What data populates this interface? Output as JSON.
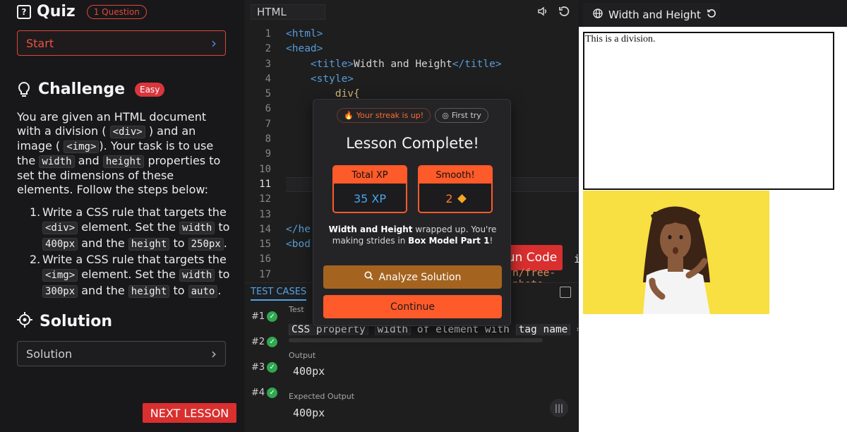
{
  "quiz": {
    "title": "Quiz",
    "count_badge": "1 Question",
    "start_label": "Start"
  },
  "challenge": {
    "title": "Challenge",
    "difficulty": "Easy",
    "desc": {
      "p1": "You are given an HTML document with a division (",
      "c1": "<div>",
      "p2": ") and an image (",
      "c2": "<img>",
      "p3": "). Your task is to use the",
      "c3": "width",
      "p4": "and",
      "c4": "height",
      "p5": "properties to set the dimensions of these elements. Follow the steps below:"
    },
    "steps": [
      {
        "num": "1.",
        "a": "Write a CSS rule that targets the",
        "c1": "<div>",
        "b": "element. Set the",
        "c2": "width",
        "c": "to",
        "c3": "400px",
        "d": "and the",
        "c4": "height",
        "e": "to",
        "c5": "250px",
        "f": "."
      },
      {
        "num": "2.",
        "a": "Write a CSS rule that targets the",
        "c1": "<img>",
        "b": "element. Set the",
        "c2": "width",
        "c": "to",
        "c3": "300px",
        "d": "and the",
        "c4": "height",
        "e": "to",
        "c5": "auto",
        "f": "."
      }
    ]
  },
  "solution": {
    "title": "Solution",
    "button_label": "Solution"
  },
  "next_lesson_label": "NEXT LESSON",
  "editor": {
    "tab_label": "HTML",
    "line_numbers": [
      "1",
      "2",
      "3",
      "4",
      "5",
      "6",
      "7",
      "8",
      "9",
      "10",
      "11",
      "12",
      "13",
      "14",
      "15",
      "16",
      "17"
    ],
    "lines": {
      "l1": "<html>",
      "l2": "<head>",
      "l3_open": "<title>",
      "l3_text": "Width and Height",
      "l3_close": "</title>",
      "l4": "<style>",
      "l5": "div{",
      "l14": "</he",
      "l15": "<bod"
    },
    "run_code_label": "un Code",
    "code_tail": "is",
    "url_tail": "n/free-photo"
  },
  "test_cases": {
    "label": "TEST CASES",
    "items": [
      "#1",
      "#2",
      "#3",
      "#4"
    ],
    "test_label": "Test",
    "test_text_1": "CSS property",
    "test_code_1": "width",
    "test_text_2": "of element with",
    "test_code_2": "tag name",
    "test_text_3": "=",
    "output_label": "Output",
    "output_value": "400px",
    "expected_label": "Expected Output",
    "expected_value": "400px"
  },
  "modal": {
    "streak_badge": "Your streak is up!",
    "first_try_badge": "First try",
    "title": "Lesson Complete!",
    "xp_label": "Total XP",
    "xp_value": "35 XP",
    "smooth_label": "Smooth!",
    "smooth_value": "2",
    "msg_bold_1": "Width and Height",
    "msg_1": "wrapped up. You're making strides in",
    "msg_bold_2": "Box Model Part 1",
    "msg_2": "!",
    "analyze_label": "Analyze Solution",
    "continue_label": "Continue"
  },
  "preview": {
    "tab_title": "Width and Height",
    "div_text": "This is a division."
  },
  "colors": {
    "accent_red": "#d92f2f",
    "accent_orange": "#ff5a2a",
    "link_blue": "#4aa3e8",
    "success_green": "#2fa84f"
  }
}
